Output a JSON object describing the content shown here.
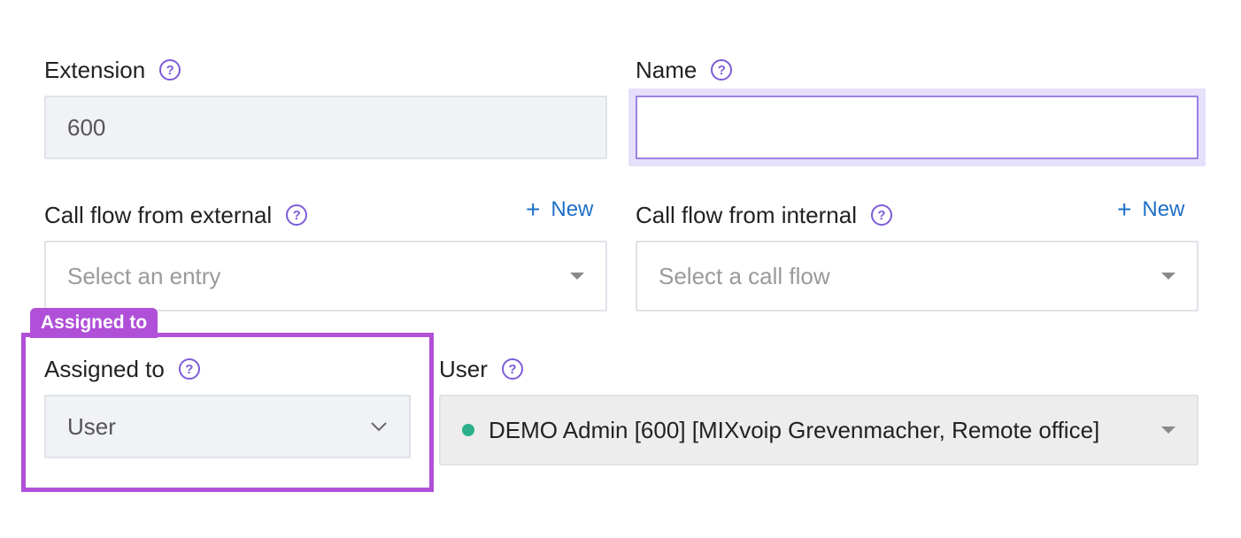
{
  "extension": {
    "label": "Extension",
    "value": "600"
  },
  "name": {
    "label": "Name",
    "value": ""
  },
  "call_flow_external": {
    "label": "Call flow from external",
    "placeholder": "Select an entry",
    "new_link": "New"
  },
  "call_flow_internal": {
    "label": "Call flow from internal",
    "placeholder": "Select a call flow",
    "new_link": "New"
  },
  "assigned_to": {
    "badge": "Assigned to",
    "label": "Assigned to",
    "value": "User"
  },
  "user": {
    "label": "User",
    "value": "DEMO Admin [600] [MIXvoip Grevenmacher, Remote office]",
    "status_color": "#2bb08a"
  },
  "help_glyph": "?",
  "icons": {
    "help": "question-circle-icon",
    "caret": "caret-down-icon",
    "chevron": "chevron-down-icon",
    "plus": "plus-icon"
  },
  "colors": {
    "accent": "#7c5cd6",
    "highlight": "#b050d8",
    "link": "#1f6fc7"
  }
}
